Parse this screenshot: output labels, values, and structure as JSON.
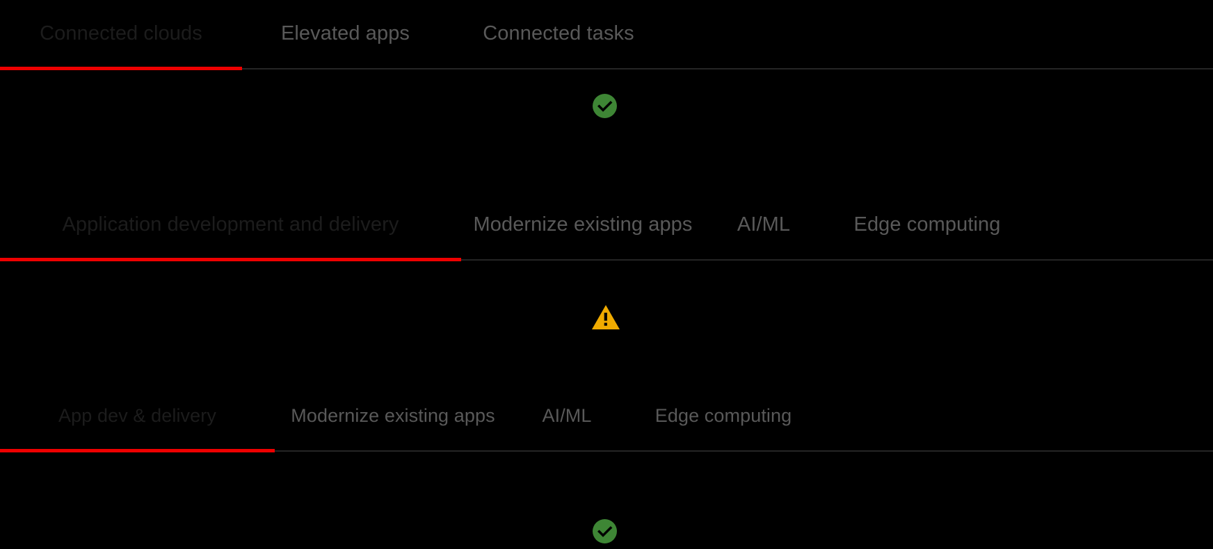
{
  "theme": {
    "background": "#000000",
    "active_tab_text": "#1c1c1c",
    "inactive_tab_text": "#595959",
    "active_underline": "#ee0000",
    "divider": "#252525",
    "success_green": "#3e8635",
    "warning_amber": "#f0ab00"
  },
  "sections": [
    {
      "id": "section-1",
      "tabs": [
        {
          "label": "Connected clouds",
          "active": true
        },
        {
          "label": "Elevated apps",
          "active": false
        },
        {
          "label": "Connected tasks",
          "active": false
        }
      ],
      "status": {
        "icon": "check-circle-icon",
        "state": "success",
        "color": "#3e8635"
      }
    },
    {
      "id": "section-2",
      "tabs": [
        {
          "label": "Application development and delivery",
          "active": true
        },
        {
          "label": "Modernize existing apps",
          "active": false
        },
        {
          "label": "AI/ML",
          "active": false
        },
        {
          "label": "Edge computing",
          "active": false
        }
      ],
      "status": {
        "icon": "warning-triangle-icon",
        "state": "warning",
        "color": "#f0ab00"
      }
    },
    {
      "id": "section-3",
      "tabs": [
        {
          "label": "App dev & delivery",
          "active": true
        },
        {
          "label": "Modernize existing apps",
          "active": false
        },
        {
          "label": "AI/ML",
          "active": false
        },
        {
          "label": "Edge computing",
          "active": false
        }
      ],
      "status": {
        "icon": "check-circle-icon",
        "state": "success",
        "color": "#3e8635"
      }
    }
  ]
}
